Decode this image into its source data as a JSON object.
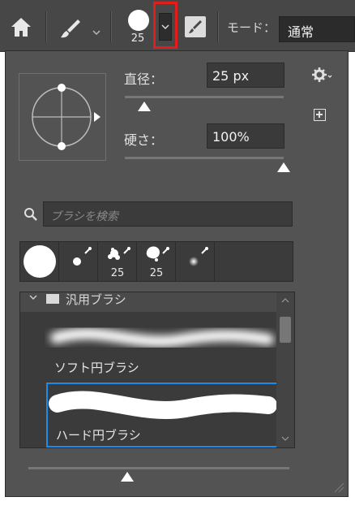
{
  "toolbar": {
    "home_icon": "home-icon",
    "tool_icon": "brush-icon",
    "brush_size": "25",
    "mode_label": "モード：",
    "mode_value": "通常"
  },
  "panel": {
    "diameter_label": "直径：",
    "diameter_value": "25 px",
    "hardness_label": "硬さ：",
    "hardness_value": "100%",
    "diameter_fraction": 0.12,
    "hardness_fraction": 1.0,
    "settings_icon": "gear-icon",
    "new_preset_icon": "new-preset-icon",
    "search_placeholder": "ブラシを検索",
    "recent_brushes": [
      {
        "label": "",
        "kind": "hard-round-large"
      },
      {
        "label": "",
        "kind": "hard-round-small"
      },
      {
        "label": "25",
        "kind": "splatter"
      },
      {
        "label": "25",
        "kind": "splatter-2"
      },
      {
        "label": "",
        "kind": "soft-small"
      }
    ],
    "group_label": "汎用ブラシ",
    "brushes": [
      {
        "name": "ソフト円ブラシ",
        "selected": false
      },
      {
        "name": "ハード円ブラシ",
        "selected": true
      }
    ],
    "size_slider_fraction": 0.38
  },
  "colors": {
    "highlight": "#e31c1c",
    "selection": "#1e8be6",
    "panel_bg": "#535353"
  }
}
